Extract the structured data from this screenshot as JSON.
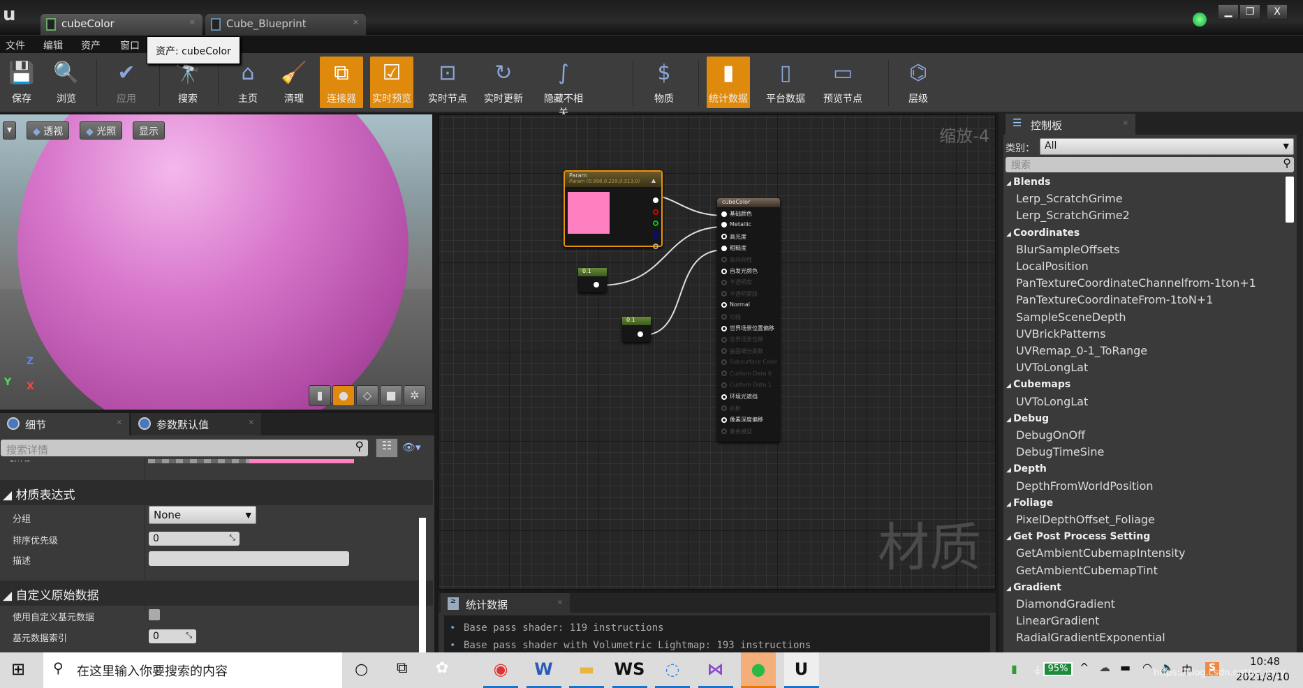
{
  "window": {
    "tabs": [
      {
        "label": "cubeColor",
        "active": true
      },
      {
        "label": "Cube_Blueprint",
        "active": false
      }
    ],
    "tab_close": "×",
    "logo": "u",
    "controls": [
      "▁",
      "❐",
      "X"
    ]
  },
  "menu": [
    "文件",
    "编辑",
    "资产",
    "窗口"
  ],
  "tooltip": "资产: cubeColor",
  "toolbar": [
    {
      "label": "保存",
      "icon": "save-icon",
      "glyph": "💾",
      "state": ""
    },
    {
      "label": "浏览",
      "icon": "browse-icon",
      "glyph": "🔍",
      "state": ""
    },
    {
      "label": "应用",
      "icon": "apply-icon",
      "glyph": "✔",
      "state": "dis"
    },
    {
      "label": "搜索",
      "icon": "search-icon",
      "glyph": "🔭",
      "state": ""
    },
    {
      "label": "主页",
      "icon": "home-icon",
      "glyph": "⌂",
      "state": ""
    },
    {
      "label": "清理",
      "icon": "clean-icon",
      "glyph": "🧹",
      "state": ""
    },
    {
      "label": "连接器",
      "icon": "connector-icon",
      "glyph": "⧉",
      "state": "on"
    },
    {
      "label": "实时预览",
      "icon": "live-preview-icon",
      "glyph": "☑",
      "state": "on"
    },
    {
      "label": "实时节点",
      "icon": "live-nodes-icon",
      "glyph": "⊡",
      "state": ""
    },
    {
      "label": "实时更新",
      "icon": "live-update-icon",
      "glyph": "↻",
      "state": ""
    },
    {
      "label": "隐藏不相关",
      "icon": "hide-unrelated-icon",
      "glyph": "∫",
      "state": ""
    },
    {
      "label": "物质",
      "icon": "substance-icon",
      "glyph": "$",
      "state": ""
    },
    {
      "label": "统计数据",
      "icon": "stats-icon",
      "glyph": "▮",
      "state": "on"
    },
    {
      "label": "平台数据",
      "icon": "platform-stats-icon",
      "glyph": "▯",
      "state": ""
    },
    {
      "label": "预览节点",
      "icon": "preview-node-icon",
      "glyph": "▭",
      "state": ""
    },
    {
      "label": "层级",
      "icon": "hierarchy-icon",
      "glyph": "⌬",
      "state": ""
    }
  ],
  "viewport": {
    "buttons": [
      "透视",
      "光照",
      "显示"
    ],
    "axes": {
      "z": "Z",
      "x": "X",
      "y": "Y"
    }
  },
  "details": {
    "tabs": [
      "细节",
      "参数默认值"
    ],
    "search_placeholder": "搜索详情",
    "cut_label": "默认值",
    "sections": [
      {
        "title": "材质表达式",
        "props": [
          {
            "label": "分组",
            "value": "None"
          },
          {
            "label": "排序优先级",
            "value": "0"
          },
          {
            "label": "描述",
            "value": ""
          }
        ]
      },
      {
        "title": "自定义原始数据",
        "props": [
          {
            "label": "使用自定义基元数据",
            "value": false
          },
          {
            "label": "基元数据索引",
            "value": "0"
          }
        ]
      }
    ]
  },
  "graph": {
    "zoom": "缩放-4",
    "watermark": "材质",
    "param_node": {
      "title": "Param",
      "subtitle": "Param (0.996,0.219,0.513,0)",
      "color": "#ff80c0"
    },
    "constants": [
      "0.1",
      "0.1"
    ],
    "result_node": {
      "title": "cubeColor",
      "pins": [
        {
          "label": "基础颜色",
          "enabled": true,
          "connected": true
        },
        {
          "label": "Metallic",
          "enabled": true,
          "connected": true
        },
        {
          "label": "高光度",
          "enabled": true,
          "connected": false
        },
        {
          "label": "粗糙度",
          "enabled": true,
          "connected": true
        },
        {
          "label": "各向异性",
          "enabled": false
        },
        {
          "label": "自发光颜色",
          "enabled": true,
          "connected": false
        },
        {
          "label": "不透明度",
          "enabled": false
        },
        {
          "label": "不透明蒙版",
          "enabled": false
        },
        {
          "label": "Normal",
          "enabled": true,
          "connected": false
        },
        {
          "label": "切线",
          "enabled": false
        },
        {
          "label": "世界场景位置偏移",
          "enabled": true,
          "connected": false
        },
        {
          "label": "世界场景位移",
          "enabled": false
        },
        {
          "label": "曲面细分乘数",
          "enabled": false
        },
        {
          "label": "Subsurface Color",
          "enabled": false
        },
        {
          "label": "Custom Data 0",
          "enabled": false
        },
        {
          "label": "Custom Data 1",
          "enabled": false
        },
        {
          "label": "环境光遮挡",
          "enabled": true,
          "connected": false
        },
        {
          "label": "折射",
          "enabled": false
        },
        {
          "label": "像素深度偏移",
          "enabled": true,
          "connected": false
        },
        {
          "label": "着色模型",
          "enabled": false
        }
      ]
    }
  },
  "stats": {
    "tab": "统计数据",
    "lines": [
      "Base pass shader: 119 instructions",
      "Base pass shader with Volumetric Lightmap: 193 instructions"
    ]
  },
  "palette": {
    "tab": "控制板",
    "category_label": "类别：",
    "category_value": "All",
    "search_placeholder": "搜索",
    "groups": [
      {
        "name": "Blends",
        "items": [
          "Lerp_ScratchGrime",
          "Lerp_ScratchGrime2"
        ]
      },
      {
        "name": "Coordinates",
        "items": [
          "BlurSampleOffsets",
          "LocalPosition",
          "PanTextureCoordinateChannelfrom-1ton+1",
          "PanTextureCoordinateFrom-1toN+1",
          "SampleSceneDepth",
          "UVBrickPatterns",
          "UVRemap_0-1_ToRange",
          "UVToLongLat"
        ]
      },
      {
        "name": "Cubemaps",
        "items": [
          "UVToLongLat"
        ]
      },
      {
        "name": "Debug",
        "items": [
          "DebugOnOff",
          "DebugTimeSine"
        ]
      },
      {
        "name": "Depth",
        "items": [
          "DepthFromWorldPosition"
        ]
      },
      {
        "name": "Foliage",
        "items": [
          "PixelDepthOffset_Foliage"
        ]
      },
      {
        "name": "Get Post Process Setting",
        "items": [
          "GetAmbientCubemapIntensity",
          "GetAmbientCubemapTint"
        ]
      },
      {
        "name": "Gradient",
        "items": [
          "DiamondGradient",
          "LinearGradient",
          "RadialGradientExponential"
        ]
      }
    ]
  },
  "taskbar": {
    "search_placeholder": "在这里输入你要搜索的内容",
    "apps": [
      "chrome",
      "word",
      "file-explorer",
      "webstorm",
      "qq-browser",
      "visual-studio",
      "wechat",
      "unreal-engine"
    ],
    "battery": "95%",
    "time": "10:48",
    "date": "2021/8/10",
    "url_watermark": "https://blog.csdn.net/ys_ys_y"
  },
  "colors": {
    "accent": "#e08a0d",
    "pink": "#ff80c0"
  }
}
